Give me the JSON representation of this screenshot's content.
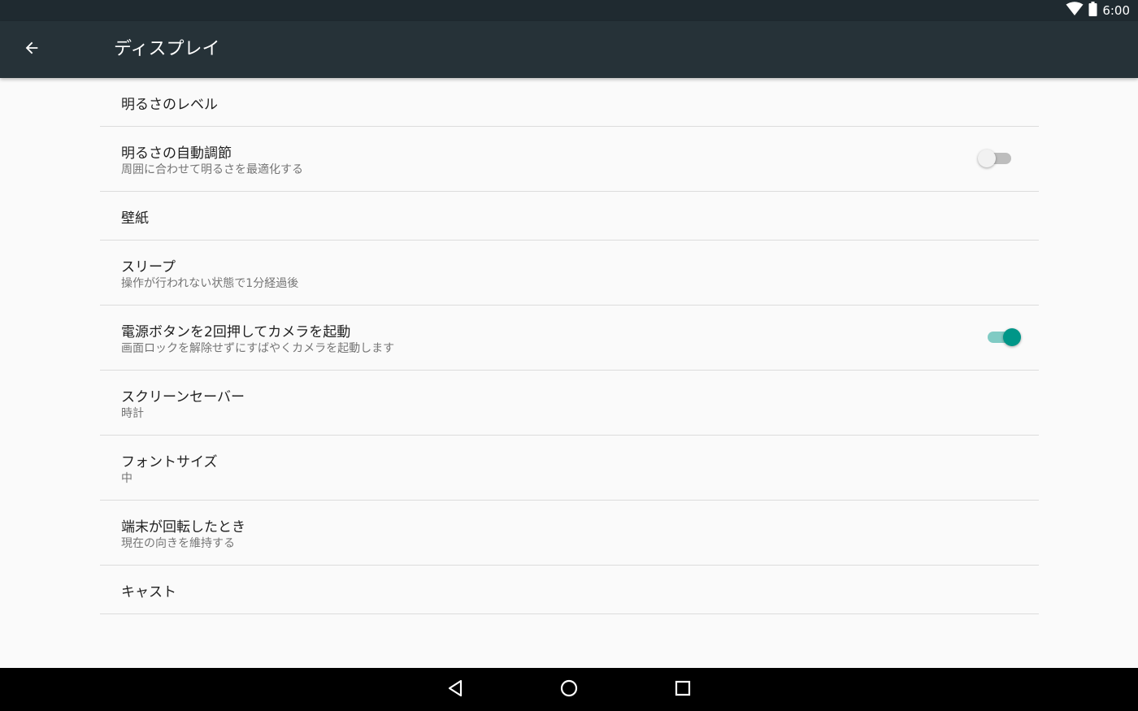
{
  "status_bar": {
    "time": "6:00",
    "icons": [
      "wifi-icon",
      "battery-icon"
    ]
  },
  "app_bar": {
    "title": "ディスプレイ",
    "back_icon": "arrow-back-icon"
  },
  "settings": [
    {
      "title": "明るさのレベル",
      "summary": null
    },
    {
      "title": "明るさの自動調節",
      "summary": "周囲に合わせて明るさを最適化する",
      "switch": "off"
    },
    {
      "title": "壁紙",
      "summary": null
    },
    {
      "title": "スリープ",
      "summary": "操作が行われない状態で1分経過後"
    },
    {
      "title": "電源ボタンを2回押してカメラを起動",
      "summary": "画面ロックを解除せずにすばやくカメラを起動します",
      "switch": "on"
    },
    {
      "title": "スクリーンセーバー",
      "summary": "時計"
    },
    {
      "title": "フォントサイズ",
      "summary": "中"
    },
    {
      "title": "端末が回転したとき",
      "summary": "現在の向きを維持する"
    },
    {
      "title": "キャスト",
      "summary": null
    }
  ],
  "nav_bar": {
    "buttons": [
      "back-triangle-icon",
      "home-circle-icon",
      "recents-square-icon"
    ]
  },
  "colors": {
    "status_bar": "#1f2a30",
    "app_bar": "#263238",
    "background": "#fafafa",
    "accent": "#009688",
    "accent_track": "#80cbc4"
  }
}
